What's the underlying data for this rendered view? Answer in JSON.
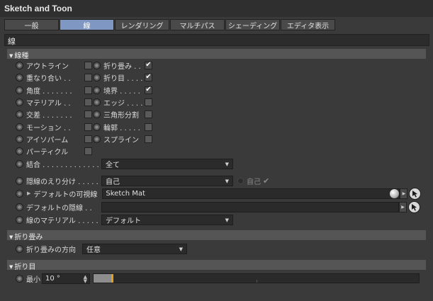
{
  "window": {
    "title": "Sketch and Toon"
  },
  "tabs": [
    {
      "label": "一般"
    },
    {
      "label": "線",
      "active": true
    },
    {
      "label": "レンダリング"
    },
    {
      "label": "マルチパス"
    },
    {
      "label": "シェーディング"
    },
    {
      "label": "エディタ表示"
    }
  ],
  "panel": {
    "title": "線"
  },
  "line_types": {
    "header": "線種",
    "left": [
      {
        "label": "アウトライン",
        "checked": false
      },
      {
        "label": "重なり合い . .",
        "checked": false
      },
      {
        "label": "角度 . . . . . . .",
        "checked": false
      },
      {
        "label": "マテリアル . .",
        "checked": false
      },
      {
        "label": "交差 . . . . . . .",
        "checked": false
      },
      {
        "label": "モーション . .",
        "checked": false
      },
      {
        "label": "アイソパーム",
        "checked": false
      },
      {
        "label": "パーティクル",
        "checked": false
      }
    ],
    "right": [
      {
        "label": "折り畳み . .",
        "checked": true
      },
      {
        "label": "折り目 . . . .",
        "checked": true
      },
      {
        "label": "境界 . . . . .",
        "checked": true
      },
      {
        "label": "エッジ . . . .",
        "checked": false
      },
      {
        "label": "三角形分割",
        "checked": false
      },
      {
        "label": "輪郭 . . . . .",
        "checked": false
      },
      {
        "label": "スプライン",
        "checked": false
      }
    ],
    "combine": {
      "label": "結合 . . . . . . . . . . . . . .",
      "value": "全て"
    },
    "hidden_select": {
      "label": "隠線のえり分け . . . . .",
      "value": "自己",
      "self_label": "自己",
      "self_checked": true
    },
    "default_visible": {
      "label": "デフォルトの可視線",
      "value": "Sketch Mat"
    },
    "default_hidden": {
      "label": "デフォルトの隠線 . .",
      "value": ""
    },
    "line_material": {
      "label": "線のマテリアル . . . . .",
      "value": "デフォルト"
    },
    "check_mark": "✔"
  },
  "fold": {
    "header": "折り畳み",
    "direction": {
      "label": "折り畳みの方向",
      "value": "任意"
    }
  },
  "crease": {
    "header": "折り目",
    "min": {
      "label": "最小",
      "value": "10 °",
      "slider_fraction": 0.055
    }
  },
  "colors": {
    "accent": "#7e97c3",
    "slider_knob": "#e8a018"
  },
  "icons": {
    "dropdown": "dropdown-arrow-icon",
    "picker": "arrow-cursor-icon",
    "material": "material-ball-icon"
  }
}
